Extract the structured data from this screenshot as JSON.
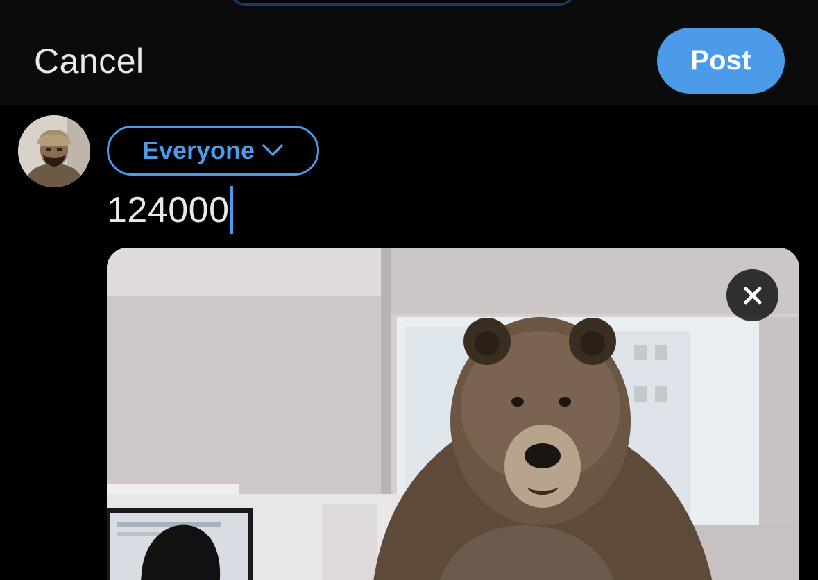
{
  "header": {
    "cancel_label": "Cancel",
    "post_label": "Post"
  },
  "compose": {
    "audience_label": "Everyone",
    "text_value": "124000"
  },
  "avatar": {
    "description": "user-avatar"
  },
  "media": {
    "subject": "bear-in-office-photo"
  },
  "icons": {
    "audience_chevron": "chevron-down-icon",
    "remove_media": "close-icon"
  },
  "colors": {
    "accent": "#4b9be8",
    "background": "#000000",
    "header_background": "#0b0b0b",
    "text": "#e7e9ea"
  }
}
